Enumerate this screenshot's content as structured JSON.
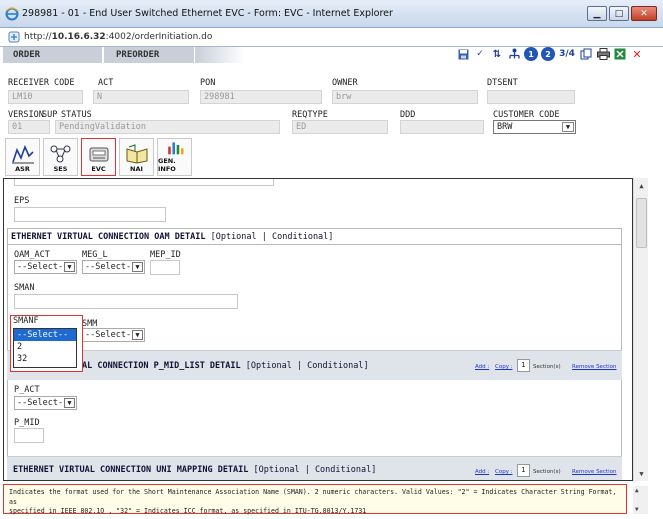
{
  "window": {
    "title": "298981 - 01 - End User Switched Ethernet EVC - Form: EVC - Internet Explorer"
  },
  "address": {
    "url_prefix": "http://",
    "url_host": "10.16.6.32",
    "url_rest": ":4002/orderInitiation.do"
  },
  "tabs": [
    "ORDER",
    "PREORDER"
  ],
  "toolbar": {
    "num1": "1",
    "num2": "2",
    "num3": "3/4"
  },
  "header": {
    "receiver_code_label": "RECEIVER CODE",
    "receiver_code_value": "LM10",
    "act_label": "ACT",
    "act_value": "N",
    "pon_label": "PON",
    "pon_value": "298981",
    "owner_label": "OWNER",
    "owner_value": "brw",
    "dtsent_label": "DTSENT",
    "version_label": "VERSION",
    "version_value": "01",
    "sup_label": "SUP",
    "status_label": "STATUS",
    "status_value": "PendingValidation",
    "reqtype_label": "REQTYPE",
    "reqtype_value": "ED",
    "ddd_label": "DDD",
    "customer_code_label": "CUSTOMER CODE",
    "customer_code_value": "BRW"
  },
  "nav": [
    "ASR",
    "SES",
    "EVC",
    "NAI",
    "GEN. INFO"
  ],
  "form": {
    "eps_label": "EPS",
    "section1_title": "ETHERNET VIRTUAL CONNECTION OAM DETAIL",
    "section1_suffix": "[Optional | Conditional]",
    "oam_act_label": "OAM_ACT",
    "oam_act_value": "--Select--",
    "meg_l_label": "MEG_L",
    "meg_l_value": "--Select--",
    "mep_id_label": "MEP_ID",
    "sman_label": "SMAN",
    "smanf_label": "SMANF",
    "smanf_options": [
      "--Select--",
      "2",
      "32"
    ],
    "smm_label": "SMM",
    "smm_value": "--Select--",
    "section2_title_visible": "AL CONNECTION P_MID_LIST DETAIL",
    "section2_suffix": "[Optional | Conditional]",
    "add_link": "Add :",
    "copy_link": "Copy :",
    "count": "1",
    "sections_label": "Section(s)",
    "remove_link": "Remove Section",
    "p_act_label": "P_ACT",
    "p_act_value": "--Select--",
    "p_mid_label": "P_MID",
    "section3_title": "ETHERNET VIRTUAL CONNECTION UNI MAPPING DETAIL",
    "section3_suffix": "[Optional | Conditional]"
  },
  "status": {
    "line1": "Indicates the format used for the Short Maintenance Association Name (SMAN). 2 numeric characters. Valid Values: \"2\" = Indicates Character String Format, as",
    "line2": "specified in IEEE 802.1Q , \"32\" = Indicates ICC format, as specified in ITU-TG.8013/Y.1731"
  }
}
